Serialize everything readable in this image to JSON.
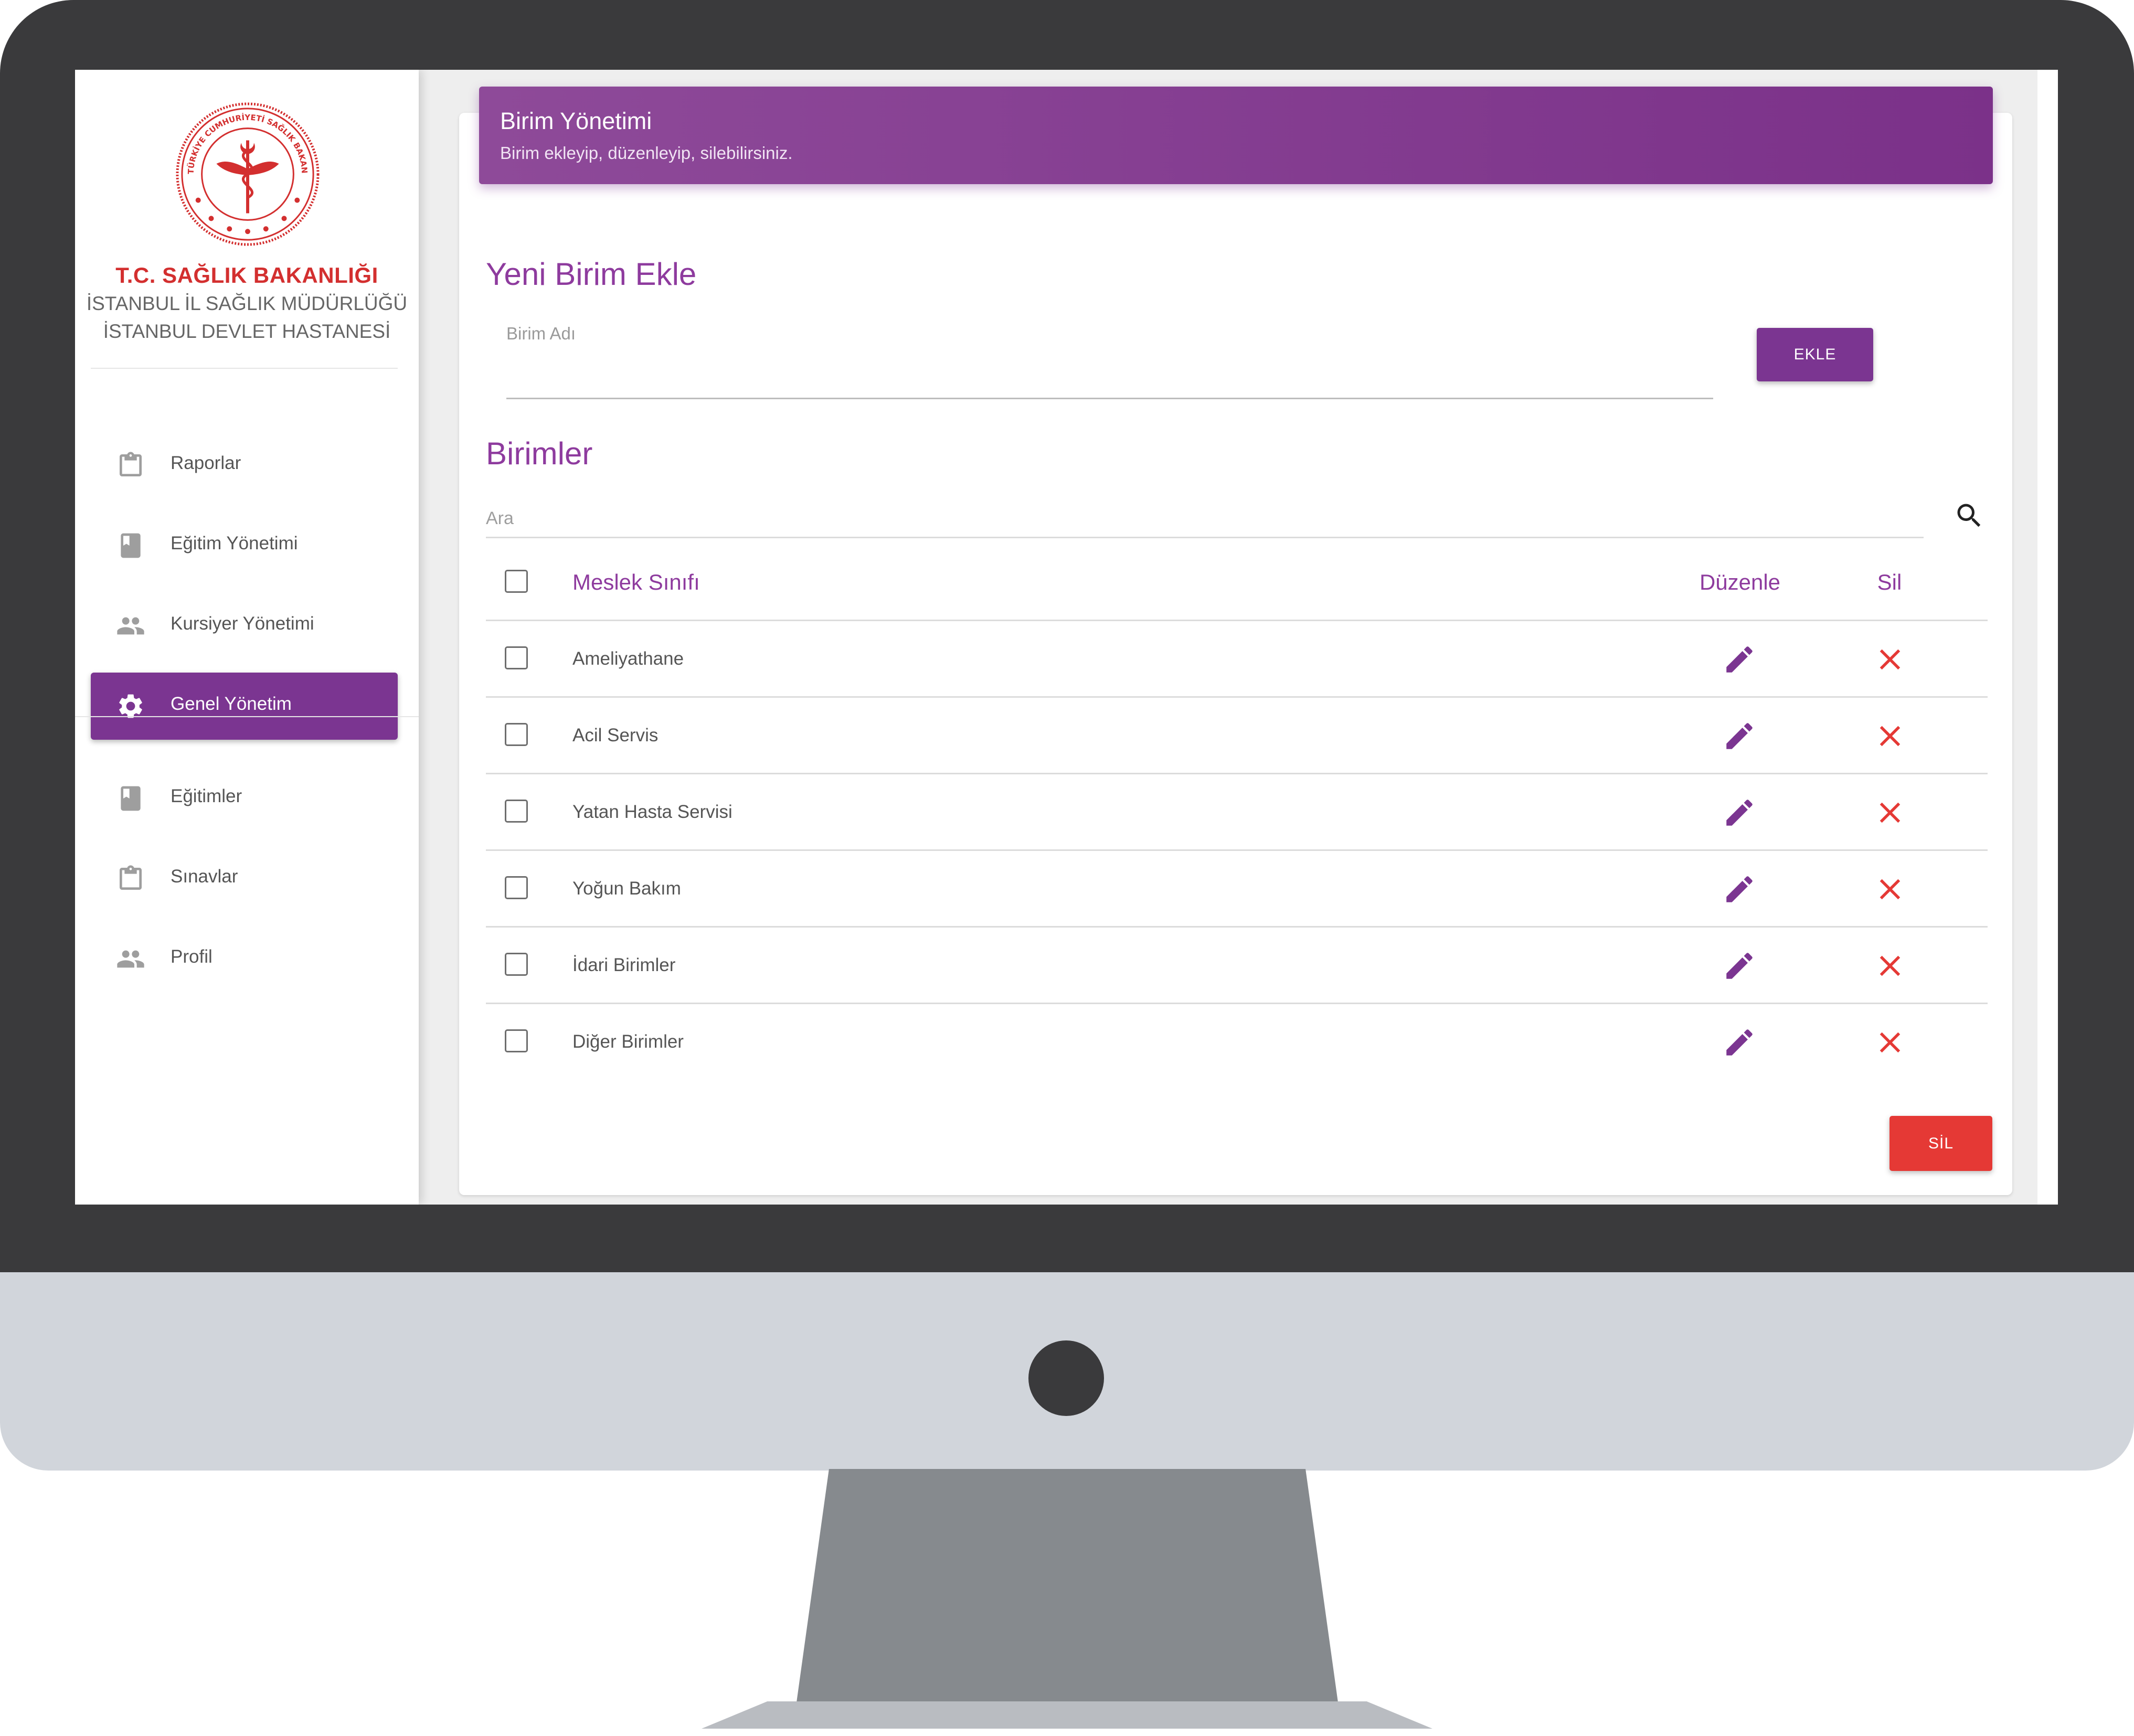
{
  "sidebar": {
    "brand": {
      "title": "T.C. SAĞLIK BAKANLIĞI",
      "line1": "İSTANBUL İL SAĞLIK MÜDÜRLÜĞÜ",
      "line2": "İSTANBUL DEVLET HASTANESİ",
      "logo_text": "TÜRKİYE CUMHURİYETİ SAĞLIK BAKANLIĞI"
    },
    "items": [
      {
        "label": "Raporlar",
        "icon": "clipboard-icon",
        "active": false
      },
      {
        "label": "Eğitim Yönetimi",
        "icon": "book-icon",
        "active": false
      },
      {
        "label": "Kursiyer Yönetimi",
        "icon": "people-icon",
        "active": false
      },
      {
        "label": "Genel Yönetim",
        "icon": "gear-icon",
        "active": true
      },
      {
        "label": "Eğitimler",
        "icon": "book-icon",
        "active": false
      },
      {
        "label": "Sınavlar",
        "icon": "clipboard-icon",
        "active": false
      },
      {
        "label": "Profil",
        "icon": "people-icon",
        "active": false
      }
    ]
  },
  "header": {
    "title": "Birim Yönetimi",
    "subtitle": "Birim ekleyip, düzenleyip, silebilirsiniz."
  },
  "add_section": {
    "title": "Yeni Birim Ekle",
    "field_label": "Birim Adı",
    "field_value": "",
    "button_label": "EKLE"
  },
  "list_section": {
    "title": "Birimler",
    "search_placeholder": "Ara",
    "columns": {
      "name": "Meslek Sınıfı",
      "edit": "Düzenle",
      "delete": "Sil"
    },
    "rows": [
      {
        "name": "Ameliyathane"
      },
      {
        "name": "Acil Servis"
      },
      {
        "name": "Yatan Hasta Servisi"
      },
      {
        "name": "Yoğun Bakım"
      },
      {
        "name": "İdari Birimler"
      },
      {
        "name": "Diğer Birimler"
      }
    ],
    "delete_button_label": "SİL"
  },
  "colors": {
    "accent": "#7b3591",
    "danger": "#e53935",
    "brand_red": "#d32f2f",
    "bezel": "#3a3a3c",
    "chin": "#d1d5db"
  }
}
